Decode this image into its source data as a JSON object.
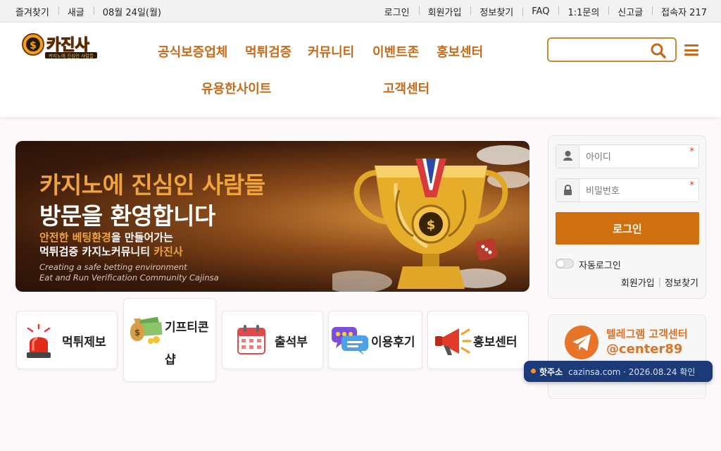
{
  "topbar": {
    "left": [
      "즐겨찾기",
      "새글",
      "08월 24일(월)"
    ],
    "right": [
      "로그인",
      "회원가입",
      "정보찾기",
      "FAQ",
      "1:1문의",
      "신고글",
      "접속자 217"
    ]
  },
  "logo": {
    "text": "카진사",
    "tagline": "카지노에 진심인 사람들"
  },
  "nav": {
    "items": [
      "공식보증업체",
      "먹튀검증",
      "커뮤니티",
      "이벤트존",
      "홍보센터",
      "유용한사이트",
      "고객센터"
    ]
  },
  "search": {
    "placeholder": "",
    "icon": "search-icon"
  },
  "banner": {
    "line1": "카지노에 진심인 사람들",
    "line2": "방문을 환영합니다",
    "line3_hl": "안전한 베팅환경",
    "line3_rest": "을 만들어가는",
    "line4_rest": "먹튀검증 카지노커뮤니티 ",
    "line4_hl": "카진사",
    "line5": "Creating a safe betting environment",
    "line6": "Eat and Run Verification Community Cajinsa"
  },
  "quick": [
    {
      "label": "먹튀제보",
      "icon": "siren-icon"
    },
    {
      "label_line1": "기프티콘",
      "label_line2": "샵",
      "icon": "money-bag-icon"
    },
    {
      "label": "출석부",
      "icon": "calendar-icon"
    },
    {
      "label": "이용후기",
      "icon": "review-chat-icon"
    },
    {
      "label": "홍보센터",
      "icon": "megaphone-icon"
    }
  ],
  "login": {
    "id_placeholder": "아이디",
    "pw_placeholder": "비밀번호",
    "required_mark": "*",
    "button": "로그인",
    "auto_login": "자동로그인",
    "join": "회원가입",
    "find": "정보찾기"
  },
  "telegram": {
    "title": "텔레그램 고객센터",
    "handle": "@center89"
  },
  "notice": {
    "key": "핫주소",
    "value": "cazinsa.com · 2026.08.24 확인"
  },
  "colors": {
    "accent": "#cf6f0f",
    "nav": "#c56a1a",
    "pill": "#1c3a78"
  }
}
